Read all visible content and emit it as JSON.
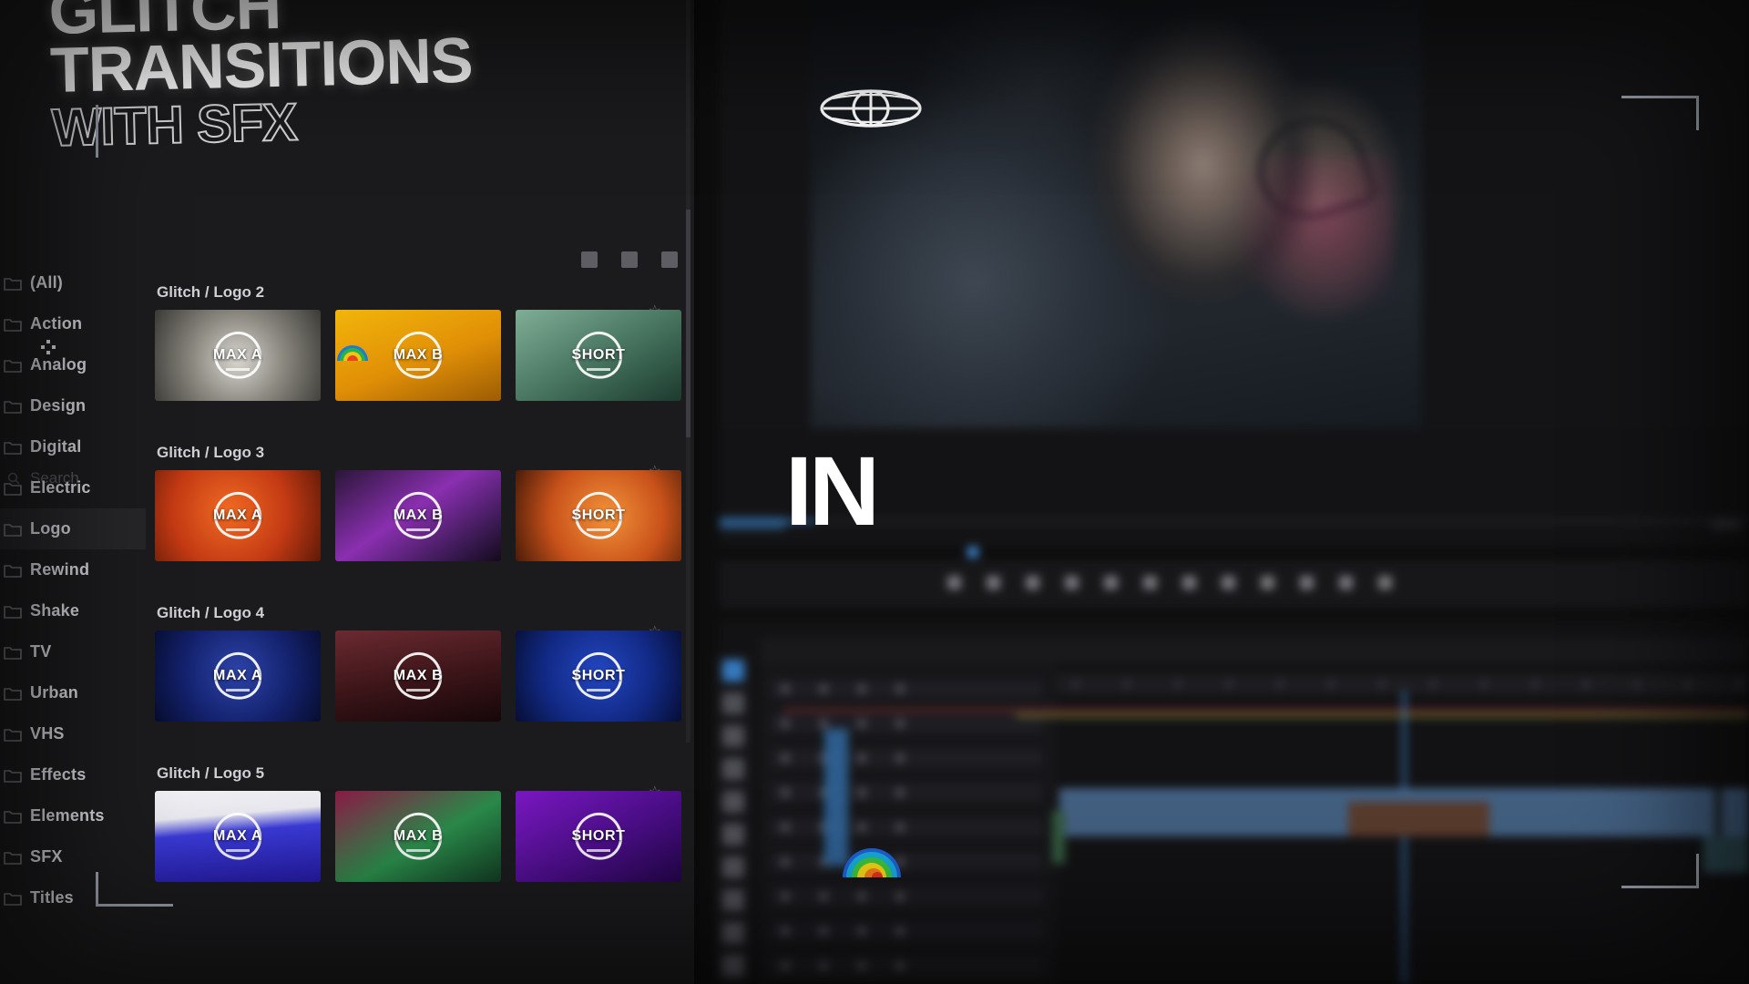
{
  "promo": {
    "title_line1": "GLITCH",
    "title_line2": "TRANSITIONS",
    "title_line3": "WITH SFX",
    "overlay_word": "IN"
  },
  "plugin_panel": {
    "expand_icon": "expand-icon",
    "brand_icon": "rainbow-brand-icon",
    "overflow_label": "•••",
    "search": {
      "placeholder": "Search",
      "value": "",
      "icon": "search-icon"
    },
    "toolbar_icons": [
      "grid-view-icon",
      "favorite-icon",
      "settings-icon"
    ],
    "categories": [
      {
        "label": "(All)",
        "active": false
      },
      {
        "label": "Action",
        "active": false
      },
      {
        "label": "Analog",
        "active": false
      },
      {
        "label": "Design",
        "active": false
      },
      {
        "label": "Digital",
        "active": false
      },
      {
        "label": "Electric",
        "active": false
      },
      {
        "label": "Logo",
        "active": true
      },
      {
        "label": "Rewind",
        "active": false
      },
      {
        "label": "Shake",
        "active": false
      },
      {
        "label": "TV",
        "active": false
      },
      {
        "label": "Urban",
        "active": false
      },
      {
        "label": "VHS",
        "active": false
      },
      {
        "label": "Effects",
        "active": false
      },
      {
        "label": "Elements",
        "active": false
      },
      {
        "label": "SFX",
        "active": false
      },
      {
        "label": "Titles",
        "active": false
      }
    ],
    "groups": [
      {
        "title": "Glitch / Logo 2",
        "star": "☆",
        "items": [
          {
            "badge": "MAX A",
            "style": "g2a"
          },
          {
            "badge": "MAX B",
            "style": "g2b"
          },
          {
            "badge": "SHORT",
            "style": "g2c"
          }
        ]
      },
      {
        "title": "Glitch / Logo 3",
        "star": "☆",
        "items": [
          {
            "badge": "MAX A",
            "style": "g3a"
          },
          {
            "badge": "MAX B",
            "style": "g3b"
          },
          {
            "badge": "SHORT",
            "style": "g3c"
          }
        ]
      },
      {
        "title": "Glitch / Logo 4",
        "star": "☆",
        "items": [
          {
            "badge": "MAX A",
            "style": "g4a"
          },
          {
            "badge": "MAX B",
            "style": "g4b"
          },
          {
            "badge": "SHORT",
            "style": "g4c"
          }
        ]
      },
      {
        "title": "Glitch / Logo 5",
        "star": "☆",
        "items": [
          {
            "badge": "MAX A",
            "style": "g5a"
          },
          {
            "badge": "MAX B",
            "style": "g5b"
          },
          {
            "badge": "SHORT",
            "style": "g5c"
          }
        ]
      }
    ]
  },
  "editor": {
    "program_monitor": {
      "globe_overlay_icon": "globe-icon"
    },
    "tools": [
      "selection-tool",
      "track-select-tool",
      "ripple-edit-tool",
      "rolling-edit-tool",
      "rate-stretch-tool",
      "razor-tool",
      "slip-tool",
      "slide-tool",
      "pen-tool",
      "type-tool"
    ],
    "cursor_icon": "rainbow-spinner-icon"
  },
  "colors": {
    "accent_blue": "#3a86d8",
    "panel_bg": "#1b1b1d",
    "active_row": "#262629",
    "text": "#d4d4da",
    "muted_text": "#56565c",
    "clip_blue": "#3f5f84",
    "bracket": "#9ca3ad"
  }
}
